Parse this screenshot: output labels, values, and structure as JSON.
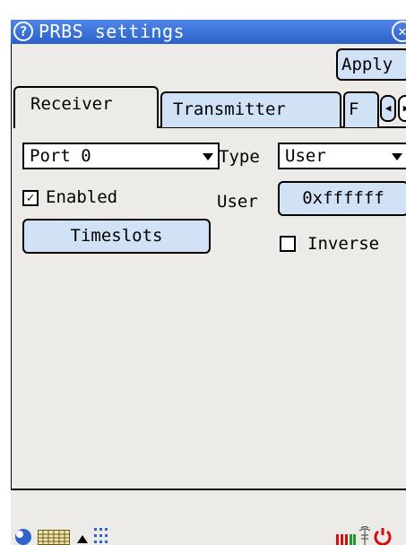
{
  "window": {
    "title": "PRBS settings",
    "help_glyph": "?",
    "close_glyph": "✕"
  },
  "toolbar": {
    "apply_label": "Apply"
  },
  "tabs": [
    {
      "label": "Receiver",
      "active": true
    },
    {
      "label": "Transmitter",
      "active": false
    },
    {
      "label": "F",
      "active": false
    }
  ],
  "tab_arrows": {
    "left": "◀",
    "right": "▶"
  },
  "receiver": {
    "port": {
      "value": "Port 0"
    },
    "type": {
      "label": "Type",
      "value": "User"
    },
    "enabled": {
      "label": "Enabled",
      "checked": true,
      "check_glyph": "✓"
    },
    "user": {
      "label": "User",
      "value": "0xffffff"
    },
    "timeslots_label": "Timeslots",
    "inverse": {
      "label": "Inverse",
      "checked": false
    }
  },
  "taskbar": {
    "icons": [
      "start-icon",
      "keyboard-icon",
      "up-arrow-icon",
      "input-grid-icon",
      "signal-bars-icon",
      "antenna-icon",
      "power-icon"
    ]
  },
  "colors": {
    "title_bar": "#2c62c8",
    "button_fill": "#d2e2f6",
    "panel_bg": "#ecebe7"
  }
}
